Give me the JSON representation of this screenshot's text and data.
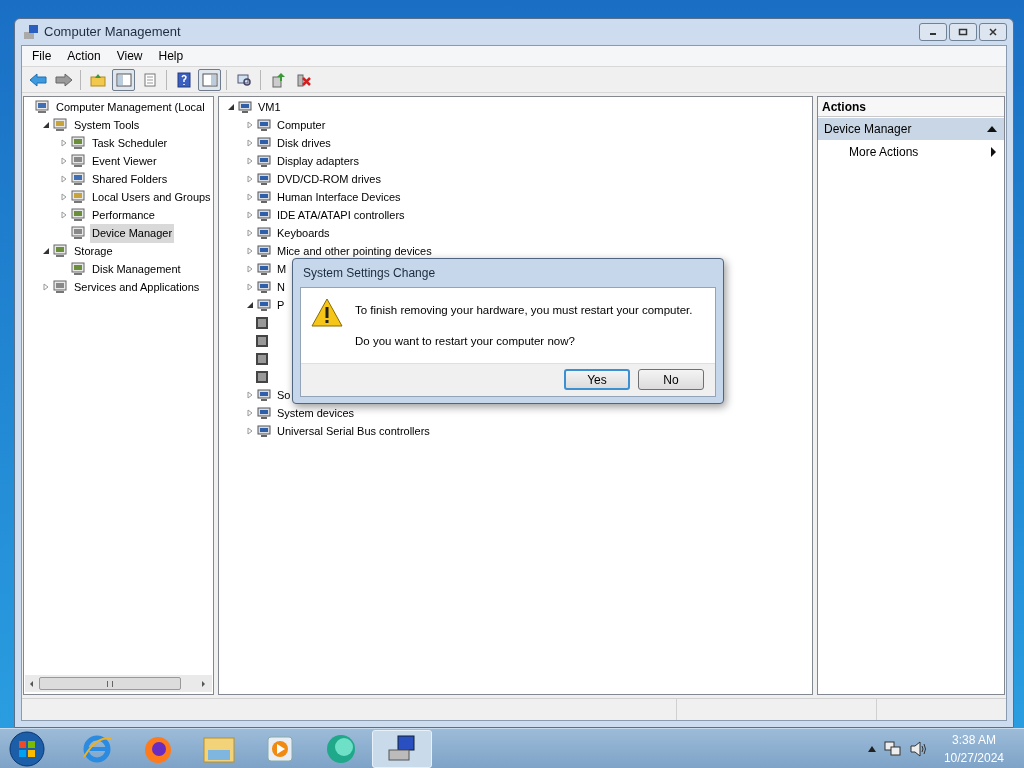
{
  "window": {
    "title": "Computer Management"
  },
  "menu": [
    "File",
    "Action",
    "View",
    "Help"
  ],
  "toolbar": [
    {
      "kind": "back",
      "pressed": false
    },
    {
      "kind": "forward",
      "pressed": false
    },
    {
      "kind": "separator"
    },
    {
      "kind": "folder-up",
      "pressed": false
    },
    {
      "kind": "tree-toggle",
      "pressed": true
    },
    {
      "kind": "properties",
      "pressed": false
    },
    {
      "kind": "separator"
    },
    {
      "kind": "help",
      "pressed": false
    },
    {
      "kind": "action-pane",
      "pressed": true
    },
    {
      "kind": "separator"
    },
    {
      "kind": "scan",
      "pressed": false
    },
    {
      "kind": "separator"
    },
    {
      "kind": "update",
      "pressed": false
    },
    {
      "kind": "uninstall",
      "pressed": false
    }
  ],
  "console_tree": [
    {
      "label": "Computer Management (Local",
      "selected": false,
      "children": [
        {
          "label": "System Tools",
          "expanded": true,
          "selected": false,
          "children": [
            {
              "label": "Task Scheduler",
              "expanded": false,
              "selected": false
            },
            {
              "label": "Event Viewer",
              "expanded": false,
              "selected": false
            },
            {
              "label": "Shared Folders",
              "expanded": false,
              "selected": false
            },
            {
              "label": "Local Users and Groups",
              "expanded": false,
              "selected": false
            },
            {
              "label": "Performance",
              "expanded": false,
              "selected": false
            },
            {
              "label": "Device Manager",
              "selected": true
            }
          ]
        },
        {
          "label": "Storage",
          "expanded": true,
          "selected": false,
          "children": [
            {
              "label": "Disk Management",
              "selected": false
            }
          ]
        },
        {
          "label": "Services and Applications",
          "expanded": false,
          "selected": false
        }
      ]
    }
  ],
  "device_tree": [
    {
      "label": "VM1",
      "expanded": true,
      "children": [
        {
          "label": "Computer",
          "expanded": false
        },
        {
          "label": "Disk drives",
          "expanded": false
        },
        {
          "label": "Display adapters",
          "expanded": false
        },
        {
          "label": "DVD/CD-ROM drives",
          "expanded": false
        },
        {
          "label": "Human Interface Devices",
          "expanded": false
        },
        {
          "label": "IDE ATA/ATAPI controllers",
          "expanded": false
        },
        {
          "label": "Keyboards",
          "expanded": false
        },
        {
          "label": "Mice and other pointing devices",
          "expanded": false
        },
        {
          "label": "M",
          "expanded": false
        },
        {
          "label": "N",
          "expanded": false
        },
        {
          "label": "P",
          "expanded": true,
          "children": [
            {
              "kind": "processor"
            },
            {
              "kind": "processor"
            },
            {
              "kind": "processor"
            },
            {
              "kind": "processor"
            }
          ]
        },
        {
          "label": "So",
          "expanded": false
        },
        {
          "label": "System devices",
          "expanded": false
        },
        {
          "label": "Universal Serial Bus controllers",
          "expanded": false
        }
      ]
    }
  ],
  "actions": {
    "title": "Actions",
    "section": {
      "label": "Device Manager",
      "expanded": true
    },
    "items": [
      {
        "label": "More Actions"
      }
    ]
  },
  "dialog": {
    "title": "System Settings Change",
    "message": [
      "To finish removing your hardware, you must restart your computer.",
      "Do you want to restart your computer now?"
    ],
    "buttons": [
      {
        "label": "Yes",
        "default": true
      },
      {
        "label": "No",
        "default": false
      }
    ]
  },
  "taskbar": {
    "apps": [
      {
        "kind": "browser-e",
        "active": false
      },
      {
        "kind": "browser-fox",
        "active": false
      },
      {
        "kind": "folder",
        "active": false
      },
      {
        "kind": "media",
        "active": false
      },
      {
        "kind": "green-app",
        "active": false
      },
      {
        "kind": "computer",
        "active": true
      }
    ],
    "clock": {
      "time": "3:38 AM",
      "date": "10/27/2024"
    }
  }
}
